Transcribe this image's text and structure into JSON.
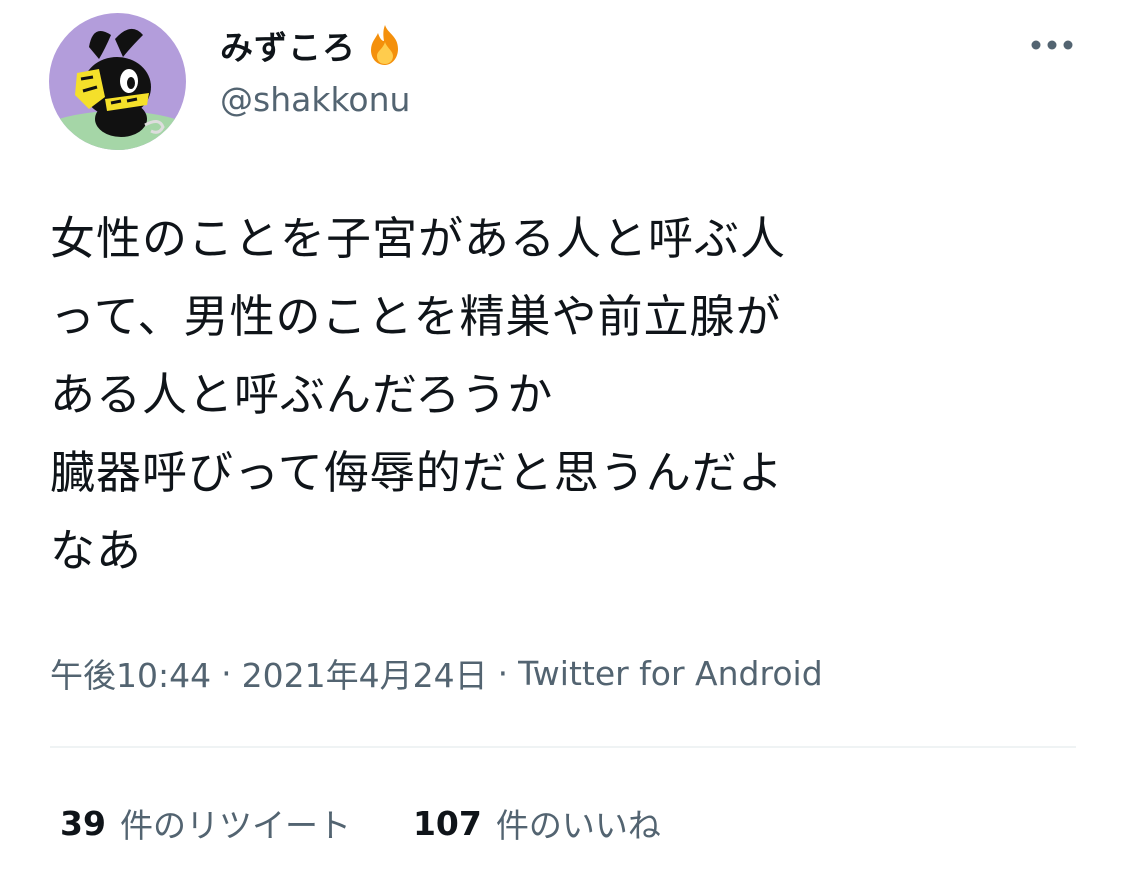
{
  "user": {
    "display_name": "みずころ",
    "handle": "@shakkonu",
    "name_badge_icon": "fire-icon",
    "avatar_icon": "avatar-image"
  },
  "more_icon": "more-icon",
  "tweet": {
    "text": "女性のことを子宮がある人と呼ぶ人\nって、男性のことを精巣や前立腺が\nある人と呼ぶんだろうか\n臓器呼びって侮辱的だと思うんだよ\nなあ"
  },
  "meta": {
    "time": "午後10:44",
    "separator1": "·",
    "date": "2021年4月24日",
    "separator2": "·",
    "source": "Twitter for Android"
  },
  "stats": {
    "retweets": {
      "count": "39",
      "label": "件のリツイート"
    },
    "likes": {
      "count": "107",
      "label": "件のいいね"
    }
  },
  "colors": {
    "text": "#0f1419",
    "secondary": "#536471",
    "divider": "#eff3f4",
    "avatar_bg": "#b39ddb",
    "avatar_grass": "#a5d6a7",
    "fire_outer": "#f4900c",
    "fire_inner": "#ffcc4d"
  }
}
